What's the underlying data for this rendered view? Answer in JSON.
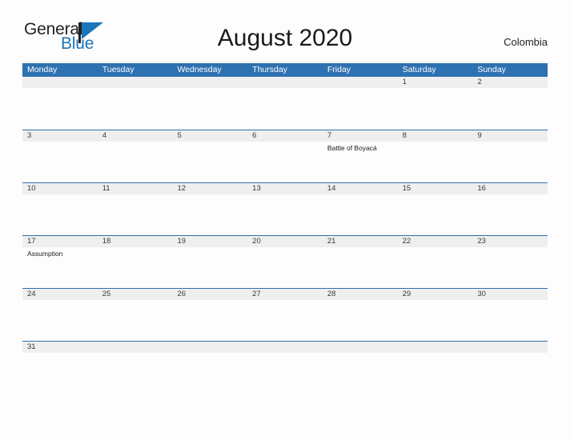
{
  "brand": {
    "name_part1": "General",
    "name_part2": "Blue",
    "mark_icon": "flag-triangle-icon",
    "color_dark": "#231f20",
    "color_blue": "#1b75bb"
  },
  "header": {
    "title": "August 2020",
    "region": "Colombia"
  },
  "colors": {
    "header_blue": "#2e71b0",
    "row_rule_blue": "#2e71b0",
    "number_strip_gray": "#efefef",
    "page_background": "#fdfdfd",
    "day_number_text": "#3a3a3a",
    "event_text": "#1a1a1a"
  },
  "calendar": {
    "weekday_headers": [
      "Monday",
      "Tuesday",
      "Wednesday",
      "Thursday",
      "Friday",
      "Saturday",
      "Sunday"
    ],
    "weeks": [
      {
        "days": [
          {
            "num": "",
            "event": ""
          },
          {
            "num": "",
            "event": ""
          },
          {
            "num": "",
            "event": ""
          },
          {
            "num": "",
            "event": ""
          },
          {
            "num": "",
            "event": ""
          },
          {
            "num": "1",
            "event": ""
          },
          {
            "num": "2",
            "event": ""
          }
        ]
      },
      {
        "days": [
          {
            "num": "3",
            "event": ""
          },
          {
            "num": "4",
            "event": ""
          },
          {
            "num": "5",
            "event": ""
          },
          {
            "num": "6",
            "event": ""
          },
          {
            "num": "7",
            "event": "Battle of Boyacá"
          },
          {
            "num": "8",
            "event": ""
          },
          {
            "num": "9",
            "event": ""
          }
        ]
      },
      {
        "days": [
          {
            "num": "10",
            "event": ""
          },
          {
            "num": "11",
            "event": ""
          },
          {
            "num": "12",
            "event": ""
          },
          {
            "num": "13",
            "event": ""
          },
          {
            "num": "14",
            "event": ""
          },
          {
            "num": "15",
            "event": ""
          },
          {
            "num": "16",
            "event": ""
          }
        ]
      },
      {
        "days": [
          {
            "num": "17",
            "event": "Assumption"
          },
          {
            "num": "18",
            "event": ""
          },
          {
            "num": "19",
            "event": ""
          },
          {
            "num": "20",
            "event": ""
          },
          {
            "num": "21",
            "event": ""
          },
          {
            "num": "22",
            "event": ""
          },
          {
            "num": "23",
            "event": ""
          }
        ]
      },
      {
        "days": [
          {
            "num": "24",
            "event": ""
          },
          {
            "num": "25",
            "event": ""
          },
          {
            "num": "26",
            "event": ""
          },
          {
            "num": "27",
            "event": ""
          },
          {
            "num": "28",
            "event": ""
          },
          {
            "num": "29",
            "event": ""
          },
          {
            "num": "30",
            "event": ""
          }
        ]
      },
      {
        "days": [
          {
            "num": "31",
            "event": ""
          },
          {
            "num": "",
            "event": ""
          },
          {
            "num": "",
            "event": ""
          },
          {
            "num": "",
            "event": ""
          },
          {
            "num": "",
            "event": ""
          },
          {
            "num": "",
            "event": ""
          },
          {
            "num": "",
            "event": ""
          }
        ]
      }
    ]
  }
}
